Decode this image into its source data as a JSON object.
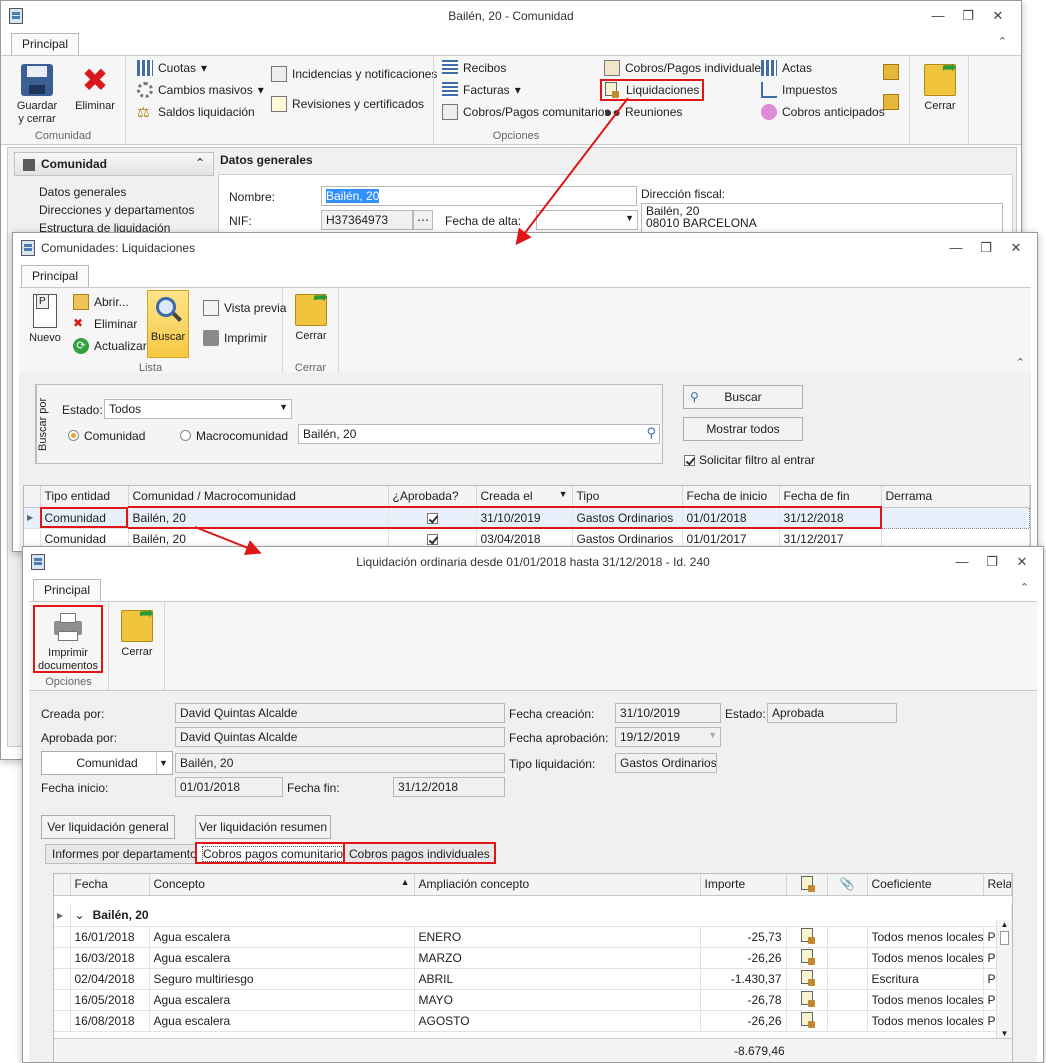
{
  "win1": {
    "title": "Bailén, 20 - Comunidad",
    "tab": "Principal",
    "btn_guardar": "Guardar\ny cerrar",
    "btn_eliminar": "Eliminar",
    "grp_comunidad": "Comunidad",
    "cuotas": "Cuotas",
    "cambios": "Cambios masivos",
    "saldos": "Saldos liquidación",
    "incidencias": "Incidencias y notificaciones",
    "revisiones": "Revisiones y certificados",
    "recibos": "Recibos",
    "facturas": "Facturas",
    "cobros_com": "Cobros/Pagos comunitarios",
    "cobros_ind": "Cobros/Pagos individuales",
    "liquidaciones": "Liquidaciones",
    "reuniones": "Reuniones",
    "actas": "Actas",
    "impuestos": "Impuestos",
    "cobros_ant": "Cobros anticipados",
    "grp_opciones": "Opciones",
    "btn_cerrar": "Cerrar",
    "nav_header": "Comunidad",
    "nav_items": [
      "Datos generales",
      "Direcciones y departamentos",
      "Estructura de liquidación"
    ],
    "section": "Datos generales",
    "lbl_nombre": "Nombre:",
    "val_nombre": "Bailén, 20",
    "lbl_nif": "NIF:",
    "val_nif": "H37364973",
    "lbl_alta": "Fecha de alta:",
    "lbl_dir": "Dirección fiscal:",
    "dir1": "Bailén, 20",
    "dir2": "08010 BARCELONA"
  },
  "win2": {
    "title": "Comunidades: Liquidaciones",
    "tab": "Principal",
    "nuevo": "Nuevo",
    "abrir": "Abrir...",
    "eliminar": "Eliminar",
    "actualizar": "Actualizar",
    "buscar": "Buscar",
    "vista": "Vista previa",
    "imprimir": "Imprimir",
    "cerrar": "Cerrar",
    "grp_lista": "Lista",
    "grp_cerrar": "Cerrar",
    "buscar_por": "Buscar por",
    "lbl_estado": "Estado:",
    "val_estado": "Todos",
    "radio_com": "Comunidad",
    "radio_macro": "Macrocomunidad",
    "val_search": "Bailén, 20",
    "btn_buscar": "Buscar",
    "btn_mostrar": "Mostrar todos",
    "chk_filtro": "Solicitar filtro al entrar",
    "columns": [
      "Tipo entidad",
      "Comunidad / Macrocomunidad",
      "¿Aprobada?",
      "Creada el",
      "Tipo",
      "Fecha de inicio",
      "Fecha de fin",
      "Derrama"
    ],
    "rows": [
      [
        "Comunidad",
        "Bailén, 20",
        "",
        "31/10/2019",
        "Gastos Ordinarios",
        "01/01/2018",
        "31/12/2018",
        ""
      ],
      [
        "Comunidad",
        "Bailén, 20",
        "",
        "03/04/2018",
        "Gastos Ordinarios",
        "01/01/2017",
        "31/12/2017",
        ""
      ]
    ]
  },
  "win3": {
    "title": "Liquidación ordinaria desde 01/01/2018 hasta 31/12/2018 - Id. 240",
    "tab": "Principal",
    "imprimir": "Imprimir\ndocumentos",
    "cerrar": "Cerrar",
    "grp_opciones": "Opciones",
    "lbl_creada": "Creada por:",
    "val_creada": "David Quintas Alcalde",
    "lbl_fcrea": "Fecha creación:",
    "val_fcrea": "31/10/2019",
    "lbl_estado": "Estado:",
    "val_estado": "Aprobada",
    "lbl_aprob": "Aprobada por:",
    "val_aprob": "David Quintas Alcalde",
    "lbl_faprob": "Fecha aprobación:",
    "val_faprob": "19/12/2019",
    "combo_com": "Comunidad",
    "val_com": "Bailén, 20",
    "lbl_tipo": "Tipo liquidación:",
    "val_tipo": "Gastos Ordinarios",
    "lbl_finicio": "Fecha inicio:",
    "val_finicio": "01/01/2018",
    "lbl_ffin": "Fecha fin:",
    "val_ffin": "31/12/2018",
    "btn_general": "Ver liquidación general",
    "btn_resumen": "Ver liquidación resumen",
    "tabs": [
      "Informes por departamento",
      "Cobros pagos comunitarios",
      "Cobros pagos individuales"
    ],
    "columns": [
      "Fecha",
      "Concepto",
      "Ampliación concepto",
      "Importe",
      "",
      "",
      "Coeficiente",
      "Relac"
    ],
    "group": "Bailén, 20",
    "rows": [
      [
        "16/01/2018",
        "Agua escalera",
        "ENERO",
        "-25,73",
        "Todos menos locales",
        "P"
      ],
      [
        "16/03/2018",
        "Agua escalera",
        "MARZO",
        "-26,26",
        "Todos menos locales",
        "P"
      ],
      [
        "02/04/2018",
        "Seguro multiriesgo",
        "ABRIL",
        "-1.430,37",
        "Escritura",
        "P"
      ],
      [
        "16/05/2018",
        "Agua escalera",
        "MAYO",
        "-26,78",
        "Todos menos locales",
        "P"
      ],
      [
        "16/08/2018",
        "Agua escalera",
        "AGOSTO",
        "-26,26",
        "Todos menos locales",
        "P"
      ]
    ],
    "total": "-8.679,46"
  }
}
